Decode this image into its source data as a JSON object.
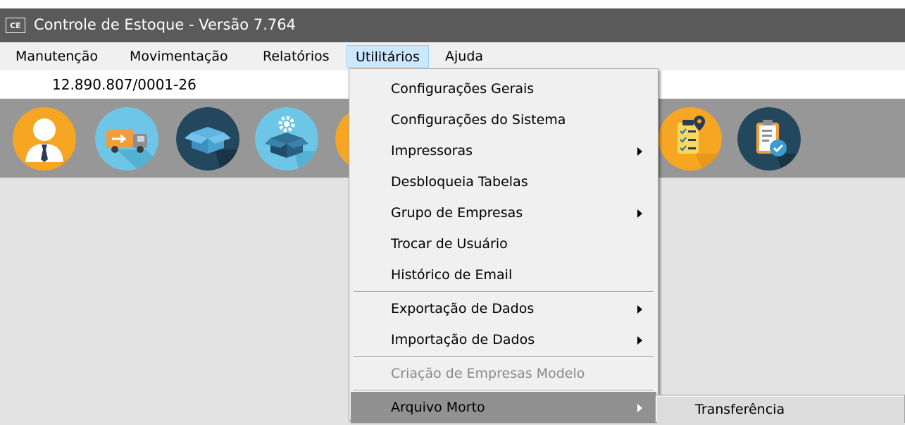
{
  "window": {
    "logo": "CE",
    "title": "Controle de Estoque - Versão 7.764"
  },
  "menubar": {
    "items": [
      {
        "label": "Manutenção"
      },
      {
        "label": "Movimentação"
      },
      {
        "label": "Relatórios"
      },
      {
        "label": "Utilitários",
        "active": true
      },
      {
        "label": "Ajuda"
      }
    ]
  },
  "company": {
    "cnpj": "12.890.807/0001-26"
  },
  "toolbar": {
    "icons": [
      "user-icon",
      "delivery-truck-icon",
      "box-icon",
      "box-settings-icon",
      "checklist-location-icon",
      "clipboard-check-icon"
    ]
  },
  "utilitarios_menu": {
    "items": [
      {
        "label": "Configurações Gerais"
      },
      {
        "label": "Configurações do Sistema"
      },
      {
        "label": "Impressoras",
        "submenu": true
      },
      {
        "label": "Desbloqueia Tabelas"
      },
      {
        "label": "Grupo de Empresas",
        "submenu": true
      },
      {
        "label": "Trocar de Usuário"
      },
      {
        "label": "Histórico de Email"
      },
      {
        "label": "Exportação de Dados",
        "submenu": true
      },
      {
        "label": "Importação de Dados",
        "submenu": true
      },
      {
        "label": "Criação de Empresas Modelo",
        "disabled": true
      },
      {
        "label": "Arquivo Morto",
        "submenu": true,
        "highlighted": true
      }
    ]
  },
  "arquivo_morto_submenu": {
    "items": [
      {
        "label": "Transferência"
      }
    ]
  },
  "colors": {
    "title_bar": "#5a5a5a",
    "toolbar_bg": "#979797",
    "menu_active": "#cce8ff",
    "highlight": "#919191"
  }
}
